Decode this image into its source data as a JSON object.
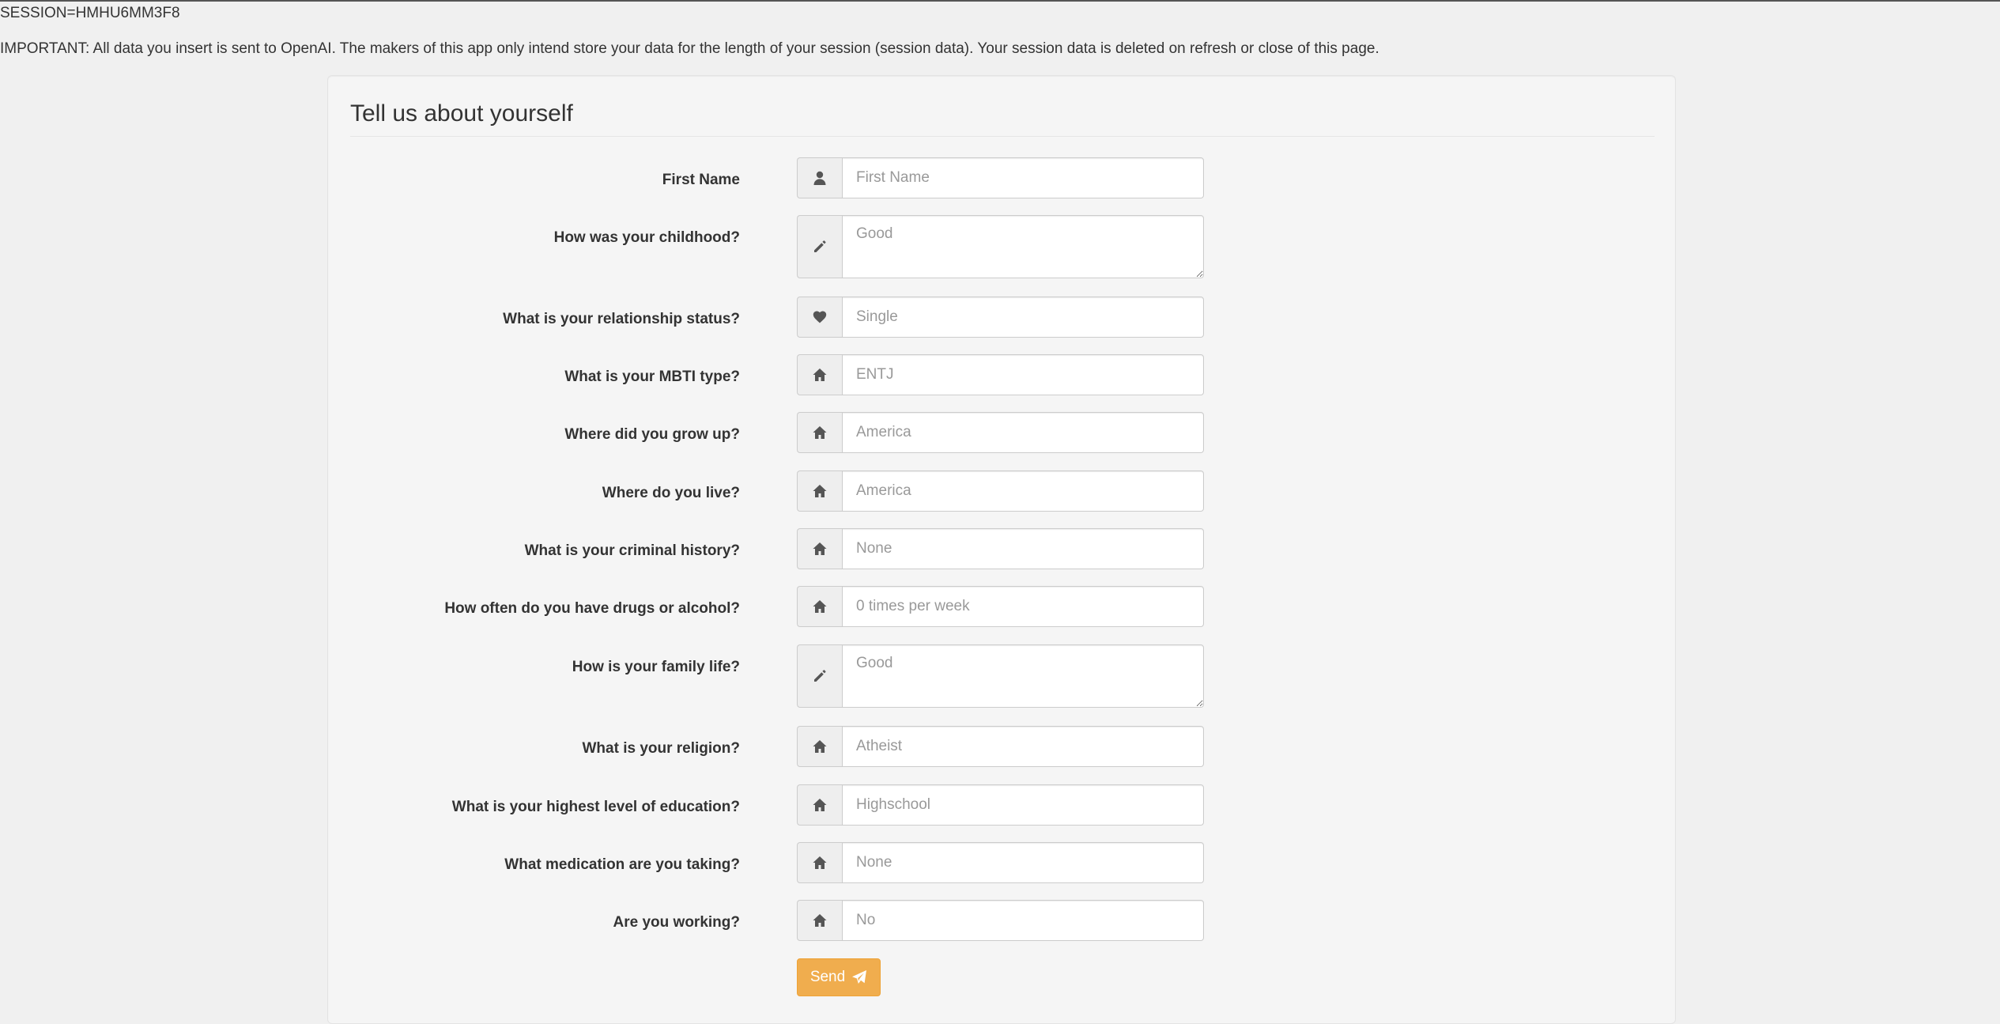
{
  "header": {
    "session": "SESSION=HMHU6MM3F8",
    "notice": "IMPORTANT: All data you insert is sent to OpenAI. The makers of this app only intend store your data for the length of your session (session data). Your session data is deleted on refresh or close of this page."
  },
  "form": {
    "title": "Tell us about yourself",
    "fields": [
      {
        "label": "First Name",
        "placeholder": "First Name",
        "icon": "user-icon",
        "type": "input"
      },
      {
        "label": "How was your childhood?",
        "placeholder": "Good",
        "icon": "pencil-icon",
        "type": "textarea"
      },
      {
        "label": "What is your relationship status?",
        "placeholder": "Single",
        "icon": "heart-icon",
        "type": "input"
      },
      {
        "label": "What is your MBTI type?",
        "placeholder": "ENTJ",
        "icon": "home-icon",
        "type": "input"
      },
      {
        "label": "Where did you grow up?",
        "placeholder": "America",
        "icon": "home-icon",
        "type": "input"
      },
      {
        "label": "Where do you live?",
        "placeholder": "America",
        "icon": "home-icon",
        "type": "input"
      },
      {
        "label": "What is your criminal history?",
        "placeholder": "None",
        "icon": "home-icon",
        "type": "input"
      },
      {
        "label": "How often do you have drugs or alcohol?",
        "placeholder": "0 times per week",
        "icon": "home-icon",
        "type": "input"
      },
      {
        "label": "How is your family life?",
        "placeholder": "Good",
        "icon": "pencil-icon",
        "type": "textarea"
      },
      {
        "label": "What is your religion?",
        "placeholder": "Atheist",
        "icon": "home-icon",
        "type": "input"
      },
      {
        "label": "What is your highest level of education?",
        "placeholder": "Highschool",
        "icon": "home-icon",
        "type": "input"
      },
      {
        "label": "What medication are you taking?",
        "placeholder": "None",
        "icon": "home-icon",
        "type": "input"
      },
      {
        "label": "Are you working?",
        "placeholder": "No",
        "icon": "home-icon",
        "type": "input"
      }
    ],
    "send_label": "Send",
    "send_icon": "paper-plane-icon"
  },
  "colors": {
    "accent": "#f0ad4e",
    "panel_bg": "#f5f5f5",
    "page_bg": "#f0f0f0"
  }
}
